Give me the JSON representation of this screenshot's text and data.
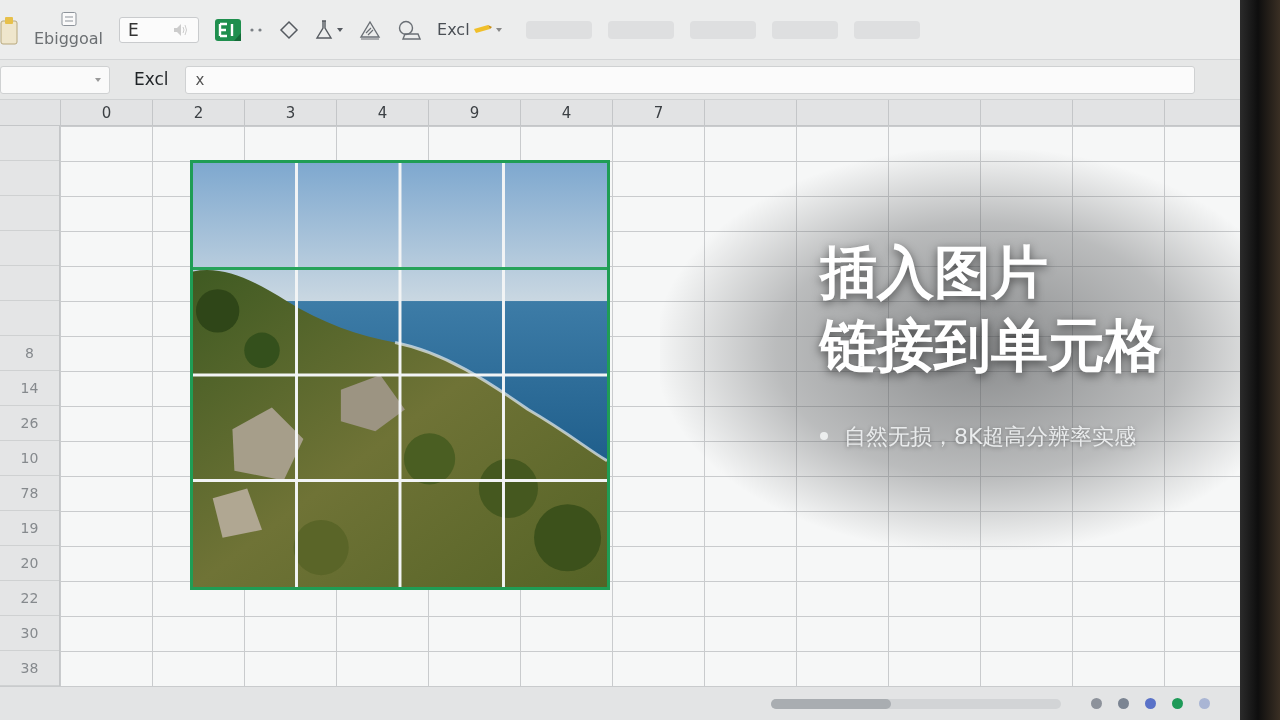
{
  "ribbon": {
    "group_label": "Ebiggoal",
    "font_field": {
      "value": "E"
    },
    "text_label": "Excl"
  },
  "formula_bar": {
    "label": "Excl",
    "formula": {
      "value": "x"
    }
  },
  "sheet": {
    "column_headers": [
      "0",
      "2",
      "3",
      "4",
      "9",
      "4",
      "7"
    ],
    "row_headers": [
      "8",
      "14",
      "26",
      "10",
      "78",
      "19",
      "20",
      "22",
      "30",
      "38"
    ]
  },
  "picture": {
    "selected": true
  },
  "overlay": {
    "title_lines": [
      "插入图片",
      "链接到单元格"
    ],
    "bullets": [
      "自然无损，8K超高分辨率实感"
    ]
  },
  "status_bar": {
    "dots": [
      {
        "color": "#8d929b"
      },
      {
        "color": "#7b8492"
      },
      {
        "color": "#5a72c8"
      },
      {
        "color": "#1e9a58"
      },
      {
        "color": "#a9b5d4"
      }
    ]
  }
}
